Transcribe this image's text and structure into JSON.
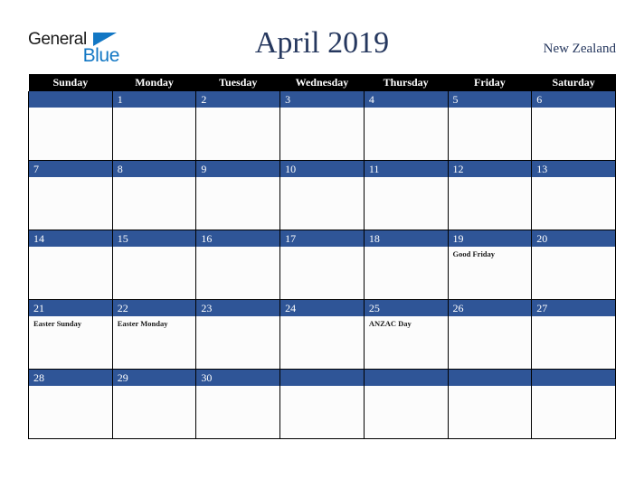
{
  "header": {
    "logo": {
      "line1": "General",
      "line2": "Blue",
      "triangle_color": "#1277c4"
    },
    "title": "April 2019",
    "country": "New Zealand"
  },
  "colors": {
    "header_row_bg": "#000000",
    "day_number_bg": "#2f5597",
    "cell_bg": "#fcfcfc",
    "title_text": "#25375e",
    "grid_line": "#000000"
  },
  "calendar": {
    "month": "April",
    "year": "2019",
    "weekday_headers": [
      "Sunday",
      "Monday",
      "Tuesday",
      "Wednesday",
      "Thursday",
      "Friday",
      "Saturday"
    ],
    "weeks": [
      [
        {
          "day": "",
          "events": []
        },
        {
          "day": "1",
          "events": []
        },
        {
          "day": "2",
          "events": []
        },
        {
          "day": "3",
          "events": []
        },
        {
          "day": "4",
          "events": []
        },
        {
          "day": "5",
          "events": []
        },
        {
          "day": "6",
          "events": []
        }
      ],
      [
        {
          "day": "7",
          "events": []
        },
        {
          "day": "8",
          "events": []
        },
        {
          "day": "9",
          "events": []
        },
        {
          "day": "10",
          "events": []
        },
        {
          "day": "11",
          "events": []
        },
        {
          "day": "12",
          "events": []
        },
        {
          "day": "13",
          "events": []
        }
      ],
      [
        {
          "day": "14",
          "events": []
        },
        {
          "day": "15",
          "events": []
        },
        {
          "day": "16",
          "events": []
        },
        {
          "day": "17",
          "events": []
        },
        {
          "day": "18",
          "events": []
        },
        {
          "day": "19",
          "events": [
            "Good Friday"
          ]
        },
        {
          "day": "20",
          "events": []
        }
      ],
      [
        {
          "day": "21",
          "events": [
            "Easter Sunday"
          ]
        },
        {
          "day": "22",
          "events": [
            "Easter Monday"
          ]
        },
        {
          "day": "23",
          "events": []
        },
        {
          "day": "24",
          "events": []
        },
        {
          "day": "25",
          "events": [
            "ANZAC Day"
          ]
        },
        {
          "day": "26",
          "events": []
        },
        {
          "day": "27",
          "events": []
        }
      ],
      [
        {
          "day": "28",
          "events": []
        },
        {
          "day": "29",
          "events": []
        },
        {
          "day": "30",
          "events": []
        },
        {
          "day": "",
          "events": []
        },
        {
          "day": "",
          "events": []
        },
        {
          "day": "",
          "events": []
        },
        {
          "day": "",
          "events": []
        }
      ]
    ]
  }
}
